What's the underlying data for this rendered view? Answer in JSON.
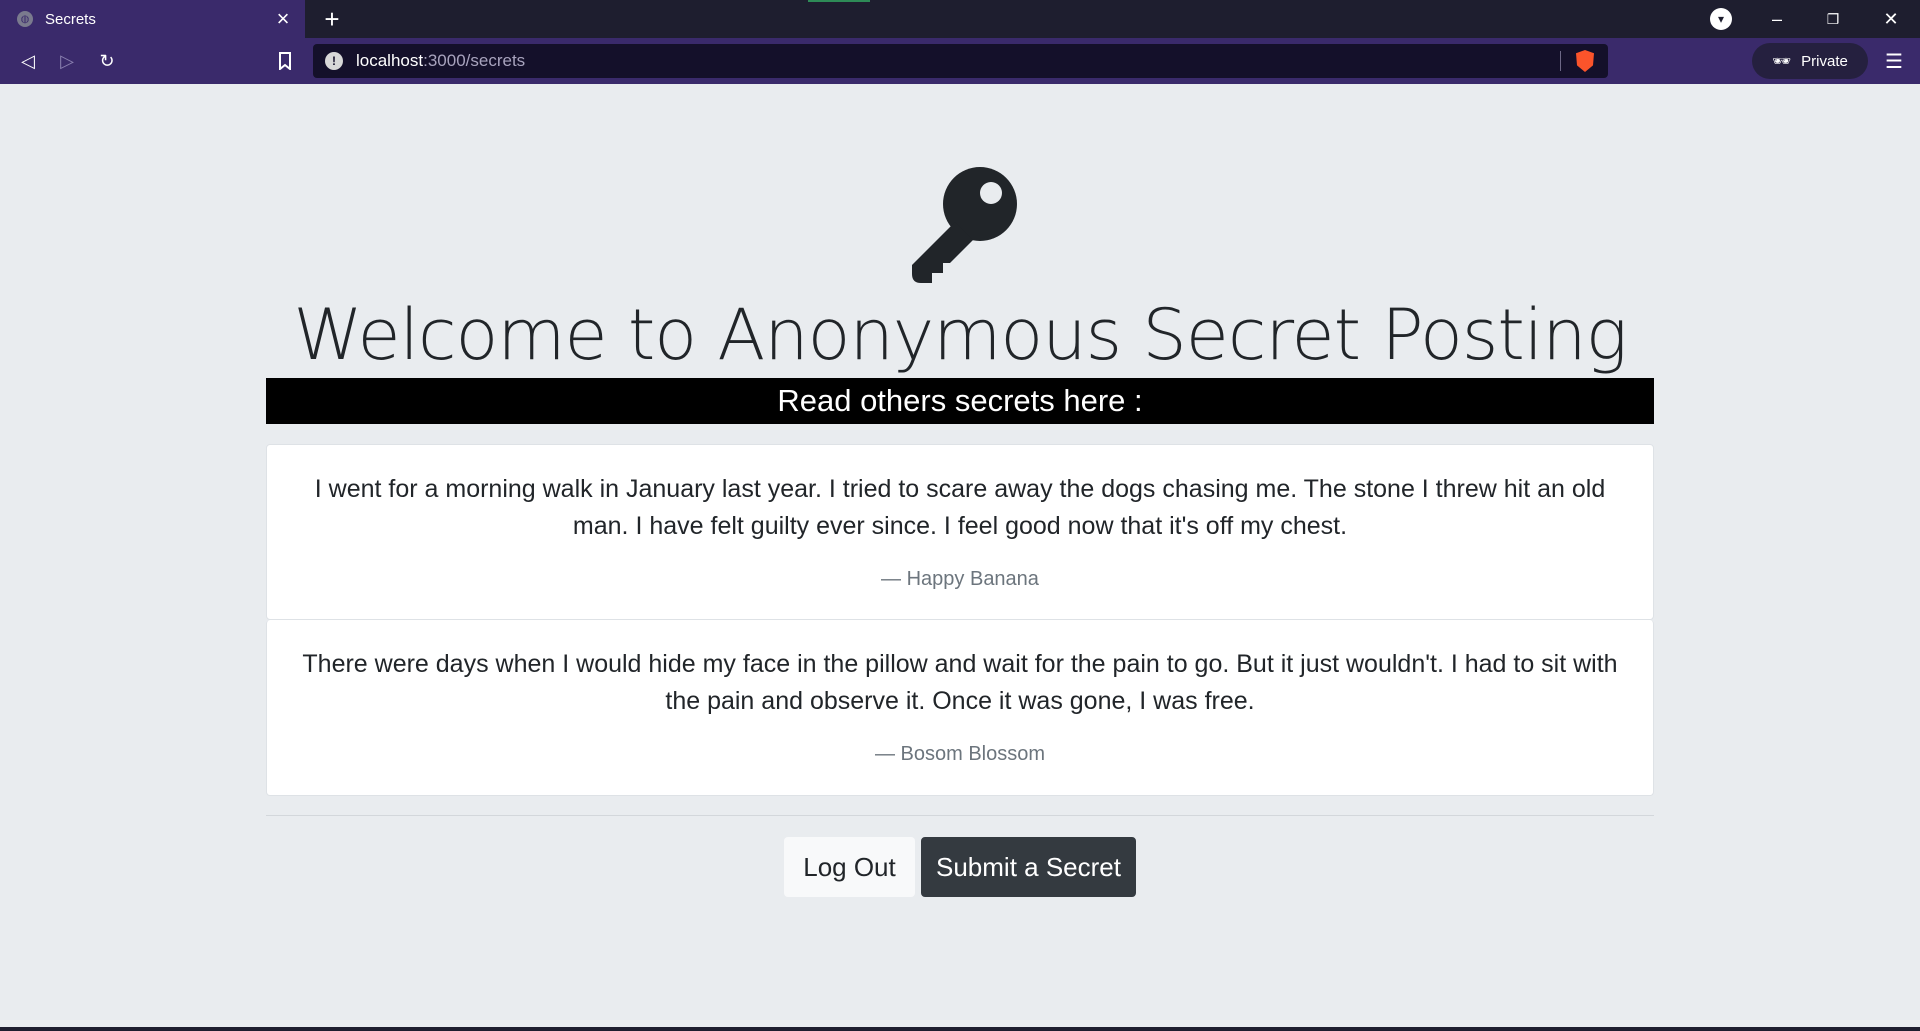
{
  "browser": {
    "tab_title": "Secrets",
    "url_host": "localhost",
    "url_path": ":3000/secrets",
    "private_label": "Private"
  },
  "page": {
    "title": "Welcome to Anonymous Secret Posting",
    "banner": "Read others secrets here :",
    "secrets": [
      {
        "text": "I went for a morning walk in January last year. I tried to scare away the dogs chasing me. The stone I threw hit an old man. I have felt guilty ever since. I feel good now that it's off my chest.",
        "author": "— Happy Banana"
      },
      {
        "text": "There were days when I would hide my face in the pillow and wait for the pain to go. But it just wouldn't. I had to sit with the pain and observe it. Once it was gone, I was free.",
        "author": "— Bosom Blossom"
      }
    ],
    "logout_label": "Log Out",
    "submit_label": "Submit a Secret"
  },
  "icons": [
    "globe-icon",
    "close-icon",
    "plus-icon",
    "back-icon",
    "forward-icon",
    "reload-icon",
    "bookmark-icon",
    "info-icon",
    "brave-shield-icon",
    "glasses-icon",
    "menu-icon",
    "key-icon"
  ],
  "colors": {
    "chrome": "#3a2a6b",
    "page_bg": "#e9ecef",
    "banner_bg": "#000000",
    "submit_bg": "#343a40"
  }
}
